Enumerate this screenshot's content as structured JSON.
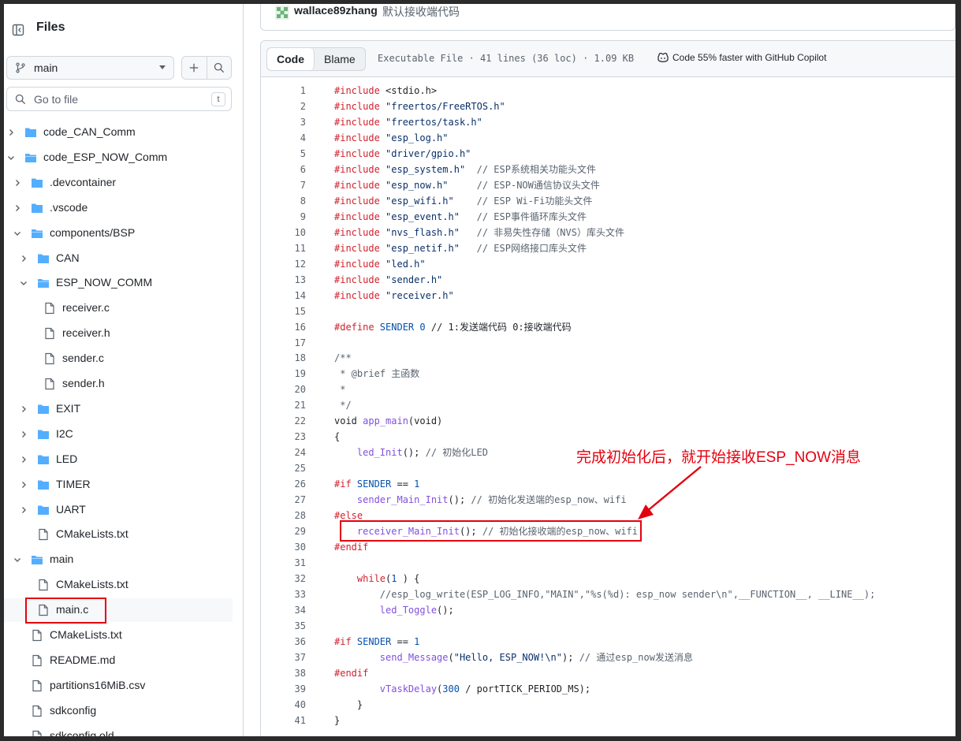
{
  "sidebar": {
    "title": "Files",
    "branch": "main",
    "goto_placeholder": "Go to file",
    "goto_shortcut": "t",
    "tree": [
      {
        "label": "code_CAN_Comm",
        "type": "folder",
        "expanded": false,
        "level": 0
      },
      {
        "label": "code_ESP_NOW_Comm",
        "type": "folder",
        "expanded": true,
        "level": 0
      },
      {
        "label": ".devcontainer",
        "type": "folder",
        "expanded": false,
        "level": 1
      },
      {
        "label": ".vscode",
        "type": "folder",
        "expanded": false,
        "level": 1
      },
      {
        "label": "components/BSP",
        "type": "folder",
        "expanded": true,
        "level": 1
      },
      {
        "label": "CAN",
        "type": "folder",
        "expanded": false,
        "level": 2
      },
      {
        "label": "ESP_NOW_COMM",
        "type": "folder",
        "expanded": true,
        "level": 2
      },
      {
        "label": "receiver.c",
        "type": "file",
        "level": 3
      },
      {
        "label": "receiver.h",
        "type": "file",
        "level": 3
      },
      {
        "label": "sender.c",
        "type": "file",
        "level": 3
      },
      {
        "label": "sender.h",
        "type": "file",
        "level": 3
      },
      {
        "label": "EXIT",
        "type": "folder",
        "expanded": false,
        "level": 2
      },
      {
        "label": "I2C",
        "type": "folder",
        "expanded": false,
        "level": 2
      },
      {
        "label": "LED",
        "type": "folder",
        "expanded": false,
        "level": 2
      },
      {
        "label": "TIMER",
        "type": "folder",
        "expanded": false,
        "level": 2
      },
      {
        "label": "UART",
        "type": "folder",
        "expanded": false,
        "level": 2
      },
      {
        "label": "CMakeLists.txt",
        "type": "file",
        "level": 2
      },
      {
        "label": "main",
        "type": "folder",
        "expanded": true,
        "level": 1
      },
      {
        "label": "CMakeLists.txt",
        "type": "file",
        "level": 2
      },
      {
        "label": "main.c",
        "type": "file",
        "level": 2,
        "selected": true
      },
      {
        "label": "CMakeLists.txt",
        "type": "file",
        "level": 1
      },
      {
        "label": "README.md",
        "type": "file",
        "level": 1
      },
      {
        "label": "partitions16MiB.csv",
        "type": "file",
        "level": 1
      },
      {
        "label": "sdkconfig",
        "type": "file",
        "level": 1
      },
      {
        "label": "sdkconfig.old",
        "type": "file",
        "level": 1
      }
    ]
  },
  "commit": {
    "author": "wallace89zhang",
    "message": "默认接收端代码"
  },
  "code_view": {
    "tabs": [
      "Code",
      "Blame"
    ],
    "active_tab": "Code",
    "file_meta": "Executable File · 41 lines (36 loc) · 1.09 KB",
    "copilot_text": "Code 55% faster with GitHub Copilot",
    "lines": [
      [
        [
          "kw",
          "#include "
        ],
        [
          "",
          "<stdio.h>"
        ]
      ],
      [
        [
          "kw",
          "#include "
        ],
        [
          "str",
          "\"freertos/FreeRTOS.h\""
        ]
      ],
      [
        [
          "kw",
          "#include "
        ],
        [
          "str",
          "\"freertos/task.h\""
        ]
      ],
      [
        [
          "kw",
          "#include "
        ],
        [
          "str",
          "\"esp_log.h\""
        ]
      ],
      [
        [
          "kw",
          "#include "
        ],
        [
          "str",
          "\"driver/gpio.h\""
        ]
      ],
      [
        [
          "kw",
          "#include "
        ],
        [
          "str",
          "\"esp_system.h\""
        ],
        [
          "cm",
          "  // ESP系统相关功能头文件"
        ]
      ],
      [
        [
          "kw",
          "#include "
        ],
        [
          "str",
          "\"esp_now.h\""
        ],
        [
          "cm",
          "     // ESP-NOW通信协议头文件"
        ]
      ],
      [
        [
          "kw",
          "#include "
        ],
        [
          "str",
          "\"esp_wifi.h\""
        ],
        [
          "cm",
          "    // ESP Wi-Fi功能头文件"
        ]
      ],
      [
        [
          "kw",
          "#include "
        ],
        [
          "str",
          "\"esp_event.h\""
        ],
        [
          "cm",
          "   // ESP事件循环库头文件"
        ]
      ],
      [
        [
          "kw",
          "#include "
        ],
        [
          "str",
          "\"nvs_flash.h\""
        ],
        [
          "cm",
          "   // 非易失性存储（NVS）库头文件"
        ]
      ],
      [
        [
          "kw",
          "#include "
        ],
        [
          "str",
          "\"esp_netif.h\""
        ],
        [
          "cm",
          "   // ESP网络接口库头文件"
        ]
      ],
      [
        [
          "kw",
          "#include "
        ],
        [
          "str",
          "\"led.h\""
        ]
      ],
      [
        [
          "kw",
          "#include "
        ],
        [
          "str",
          "\"sender.h\""
        ]
      ],
      [
        [
          "kw",
          "#include "
        ],
        [
          "str",
          "\"receiver.h\""
        ]
      ],
      [],
      [
        [
          "kw",
          "#define "
        ],
        [
          "num",
          "SENDER"
        ],
        [
          "",
          " "
        ],
        [
          "num",
          "0"
        ],
        [
          "",
          " // 1:发送端代码 0:接收端代码"
        ]
      ],
      [],
      [
        [
          "cm",
          "/**"
        ]
      ],
      [
        [
          "cm",
          " * @brief 主函数"
        ]
      ],
      [
        [
          "cm",
          " *"
        ]
      ],
      [
        [
          "cm",
          " */"
        ]
      ],
      [
        [
          "",
          "void "
        ],
        [
          "fn",
          "app_main"
        ],
        [
          "",
          "(void)"
        ]
      ],
      [
        [
          "",
          "{"
        ]
      ],
      [
        [
          "",
          "    "
        ],
        [
          "fn",
          "led_Init"
        ],
        [
          "",
          "(); "
        ],
        [
          "cm",
          "// 初始化LED"
        ]
      ],
      [],
      [
        [
          "kw",
          "#if "
        ],
        [
          "num",
          "SENDER"
        ],
        [
          "",
          " == "
        ],
        [
          "num",
          "1"
        ]
      ],
      [
        [
          "",
          "    "
        ],
        [
          "fn",
          "sender_Main_Init"
        ],
        [
          "",
          "(); "
        ],
        [
          "cm",
          "// 初始化发送端的esp_now、wifi"
        ]
      ],
      [
        [
          "kw",
          "#else"
        ]
      ],
      [
        [
          "",
          "    "
        ],
        [
          "fn",
          "receiver_Main_Init"
        ],
        [
          "",
          "(); "
        ],
        [
          "cm",
          "// 初始化接收端的esp_now、wifi"
        ]
      ],
      [
        [
          "kw",
          "#endif"
        ]
      ],
      [],
      [
        [
          "",
          "    "
        ],
        [
          "kw",
          "while"
        ],
        [
          "",
          "("
        ],
        [
          "num",
          "1"
        ],
        [
          "",
          " ) {"
        ]
      ],
      [
        [
          "",
          "        "
        ],
        [
          "cm",
          "//esp_log_write(ESP_LOG_INFO,\"MAIN\",\"%s(%d): esp_now sender\\n\",__FUNCTION__, __LINE__);"
        ]
      ],
      [
        [
          "",
          "        "
        ],
        [
          "fn",
          "led_Toggle"
        ],
        [
          "",
          "();"
        ]
      ],
      [],
      [
        [
          "kw",
          "#if "
        ],
        [
          "num",
          "SENDER"
        ],
        [
          "",
          " == "
        ],
        [
          "num",
          "1"
        ]
      ],
      [
        [
          "",
          "        "
        ],
        [
          "fn",
          "send_Message"
        ],
        [
          "",
          "("
        ],
        [
          "str",
          "\"Hello, ESP_NOW!\\n\""
        ],
        [
          "",
          "); "
        ],
        [
          "cm",
          "// 通过esp_now发送消息"
        ]
      ],
      [
        [
          "kw",
          "#endif"
        ]
      ],
      [
        [
          "",
          "        "
        ],
        [
          "fn",
          "vTaskDelay"
        ],
        [
          "",
          "("
        ],
        [
          "num",
          "300"
        ],
        [
          "",
          " / portTICK_PERIOD_MS);"
        ]
      ],
      [
        [
          "",
          "    }"
        ]
      ],
      [
        [
          "",
          "}"
        ]
      ]
    ]
  },
  "annotation": {
    "text": "完成初始化后，就开始接收ESP_NOW消息",
    "color": "#e4000f"
  }
}
